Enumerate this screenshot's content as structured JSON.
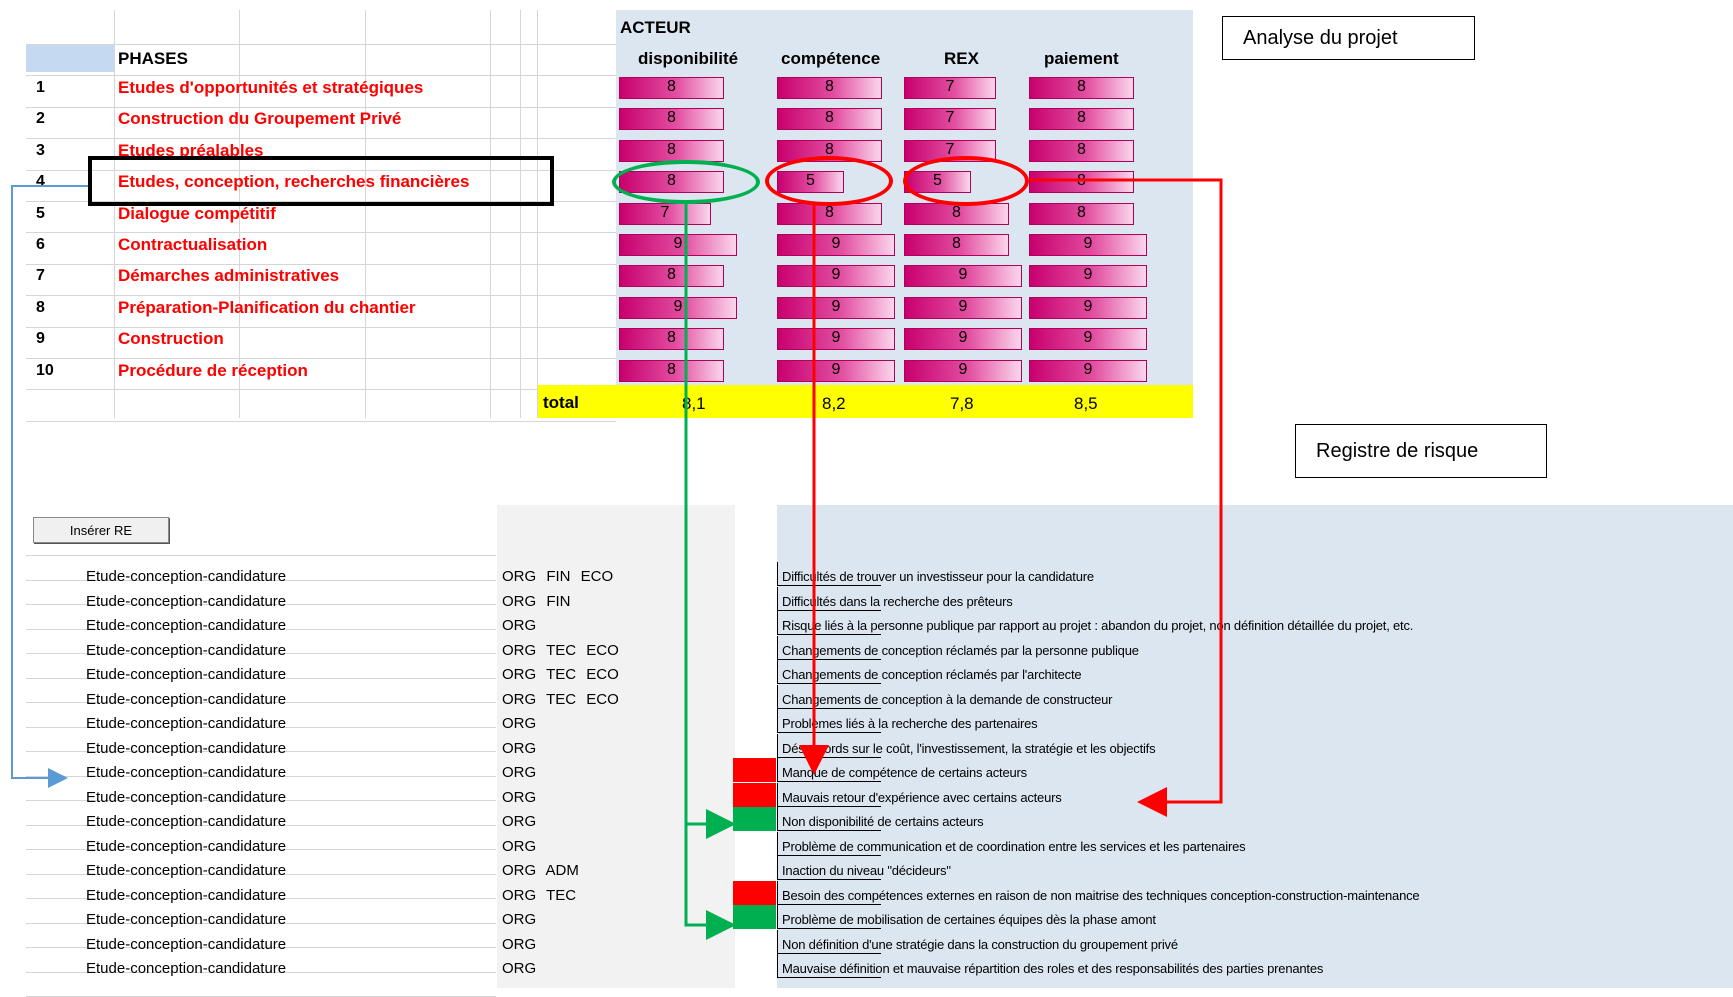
{
  "header": {
    "acteur": "ACTEUR",
    "phases": "PHASES",
    "columns": [
      "disponibilité",
      "compétence",
      "REX",
      "paiement"
    ]
  },
  "phases": [
    {
      "num": "1",
      "name": "Etudes d'opportunités et stratégiques",
      "values": [
        "8",
        "8",
        "7",
        "8"
      ],
      "fill": [
        0.82,
        0.82,
        0.72,
        0.82
      ]
    },
    {
      "num": "2",
      "name": "Construction du Groupement Privé",
      "values": [
        "8",
        "8",
        "7",
        "8"
      ],
      "fill": [
        0.82,
        0.82,
        0.72,
        0.82
      ]
    },
    {
      "num": "3",
      "name": "Etudes préalables",
      "values": [
        "8",
        "8",
        "7",
        "8"
      ],
      "fill": [
        0.82,
        0.82,
        0.72,
        0.82
      ]
    },
    {
      "num": "4",
      "name": "Etudes, conception, recherches financières",
      "values": [
        "8",
        "5",
        "5",
        "8"
      ],
      "fill": [
        0.82,
        0.52,
        0.52,
        0.82
      ]
    },
    {
      "num": "5",
      "name": "Dialogue compétitif",
      "values": [
        "7",
        "8",
        "8",
        "8"
      ],
      "fill": [
        0.72,
        0.82,
        0.82,
        0.82
      ]
    },
    {
      "num": "6",
      "name": "Contractualisation",
      "values": [
        "9",
        "9",
        "8",
        "9"
      ],
      "fill": [
        0.92,
        0.92,
        0.82,
        0.92
      ]
    },
    {
      "num": "7",
      "name": "Démarches administratives",
      "values": [
        "8",
        "9",
        "9",
        "9"
      ],
      "fill": [
        0.82,
        0.92,
        0.92,
        0.92
      ]
    },
    {
      "num": "8",
      "name": "Préparation-Planification du chantier",
      "values": [
        "9",
        "9",
        "9",
        "9"
      ],
      "fill": [
        0.92,
        0.92,
        0.92,
        0.92
      ]
    },
    {
      "num": "9",
      "name": "Construction",
      "values": [
        "8",
        "9",
        "9",
        "9"
      ],
      "fill": [
        0.82,
        0.92,
        0.92,
        0.92
      ]
    },
    {
      "num": "10",
      "name": "Procédure de réception",
      "values": [
        "8",
        "9",
        "9",
        "9"
      ],
      "fill": [
        0.82,
        0.92,
        0.92,
        0.92
      ]
    }
  ],
  "total": {
    "label": "total",
    "values": [
      "8,1",
      "8,2",
      "7,8",
      "8,5"
    ]
  },
  "labels": {
    "analyse": "Analyse du projet",
    "registre": "Registre de risque"
  },
  "insert_button": "Insérer RE",
  "register": [
    {
      "phase": "Etude-conception-candidature",
      "cat": "ORG FIN ECO",
      "desc": "Difficultés de trouver un investisseur pour la candidature",
      "flag": ""
    },
    {
      "phase": "Etude-conception-candidature",
      "cat": "ORG FIN",
      "desc": "Difficultés dans la recherche des prêteurs",
      "flag": ""
    },
    {
      "phase": "Etude-conception-candidature",
      "cat": "ORG",
      "desc": "Risque liés à la personne publique par rapport au projet : abandon du projet, non définition détaillée du projet, etc.",
      "flag": ""
    },
    {
      "phase": "Etude-conception-candidature",
      "cat": "ORG TEC ECO",
      "desc": "Changements de conception réclamés par la personne publique",
      "flag": ""
    },
    {
      "phase": "Etude-conception-candidature",
      "cat": "ORG TEC ECO",
      "desc": "Changements de conception réclamés par l'architecte",
      "flag": ""
    },
    {
      "phase": "Etude-conception-candidature",
      "cat": "ORG TEC ECO",
      "desc": "Changements de conception à la demande de constructeur",
      "flag": ""
    },
    {
      "phase": "Etude-conception-candidature",
      "cat": "ORG",
      "desc": "Problèmes liés à la recherche des partenaires",
      "flag": ""
    },
    {
      "phase": "Etude-conception-candidature",
      "cat": "ORG",
      "desc": "Désaccords sur le coût, l'investissement, la stratégie et les objectifs",
      "flag": ""
    },
    {
      "phase": "Etude-conception-candidature",
      "cat": "ORG",
      "desc": "Manque de compétence de certains acteurs",
      "flag": "red"
    },
    {
      "phase": "Etude-conception-candidature",
      "cat": "ORG",
      "desc": "Mauvais retour d'expérience avec certains acteurs",
      "flag": "red"
    },
    {
      "phase": "Etude-conception-candidature",
      "cat": "ORG",
      "desc": "Non disponibilité de certains acteurs",
      "flag": "green"
    },
    {
      "phase": "Etude-conception-candidature",
      "cat": "ORG",
      "desc": "Problème de communication et de coordination entre les services et les partenaires",
      "flag": ""
    },
    {
      "phase": "Etude-conception-candidature",
      "cat": "ORG ADM",
      "desc": "Inaction du niveau \"décideurs\"",
      "flag": ""
    },
    {
      "phase": "Etude-conception-candidature",
      "cat": "ORG TEC",
      "desc": "Besoin des compétences externes en raison de non maitrise des techniques conception-construction-maintenance",
      "flag": "red"
    },
    {
      "phase": "Etude-conception-candidature",
      "cat": "ORG",
      "desc": "Problème de mobilisation de certaines équipes dès la phase amont",
      "flag": "green"
    },
    {
      "phase": "Etude-conception-candidature",
      "cat": "ORG",
      "desc": "Non définition d'une stratégie dans la construction du groupement privé",
      "flag": ""
    },
    {
      "phase": "Etude-conception-candidature",
      "cat": "ORG",
      "desc": "Mauvaise définition et mauvaise répartition des roles et des responsabilités des parties prenantes",
      "flag": ""
    }
  ],
  "colors": {
    "red": "#ff0000",
    "green": "#00b050",
    "blue_arrow": "#5b9bd5",
    "panel": "#dce6f1",
    "total_bg": "#ffff00"
  }
}
